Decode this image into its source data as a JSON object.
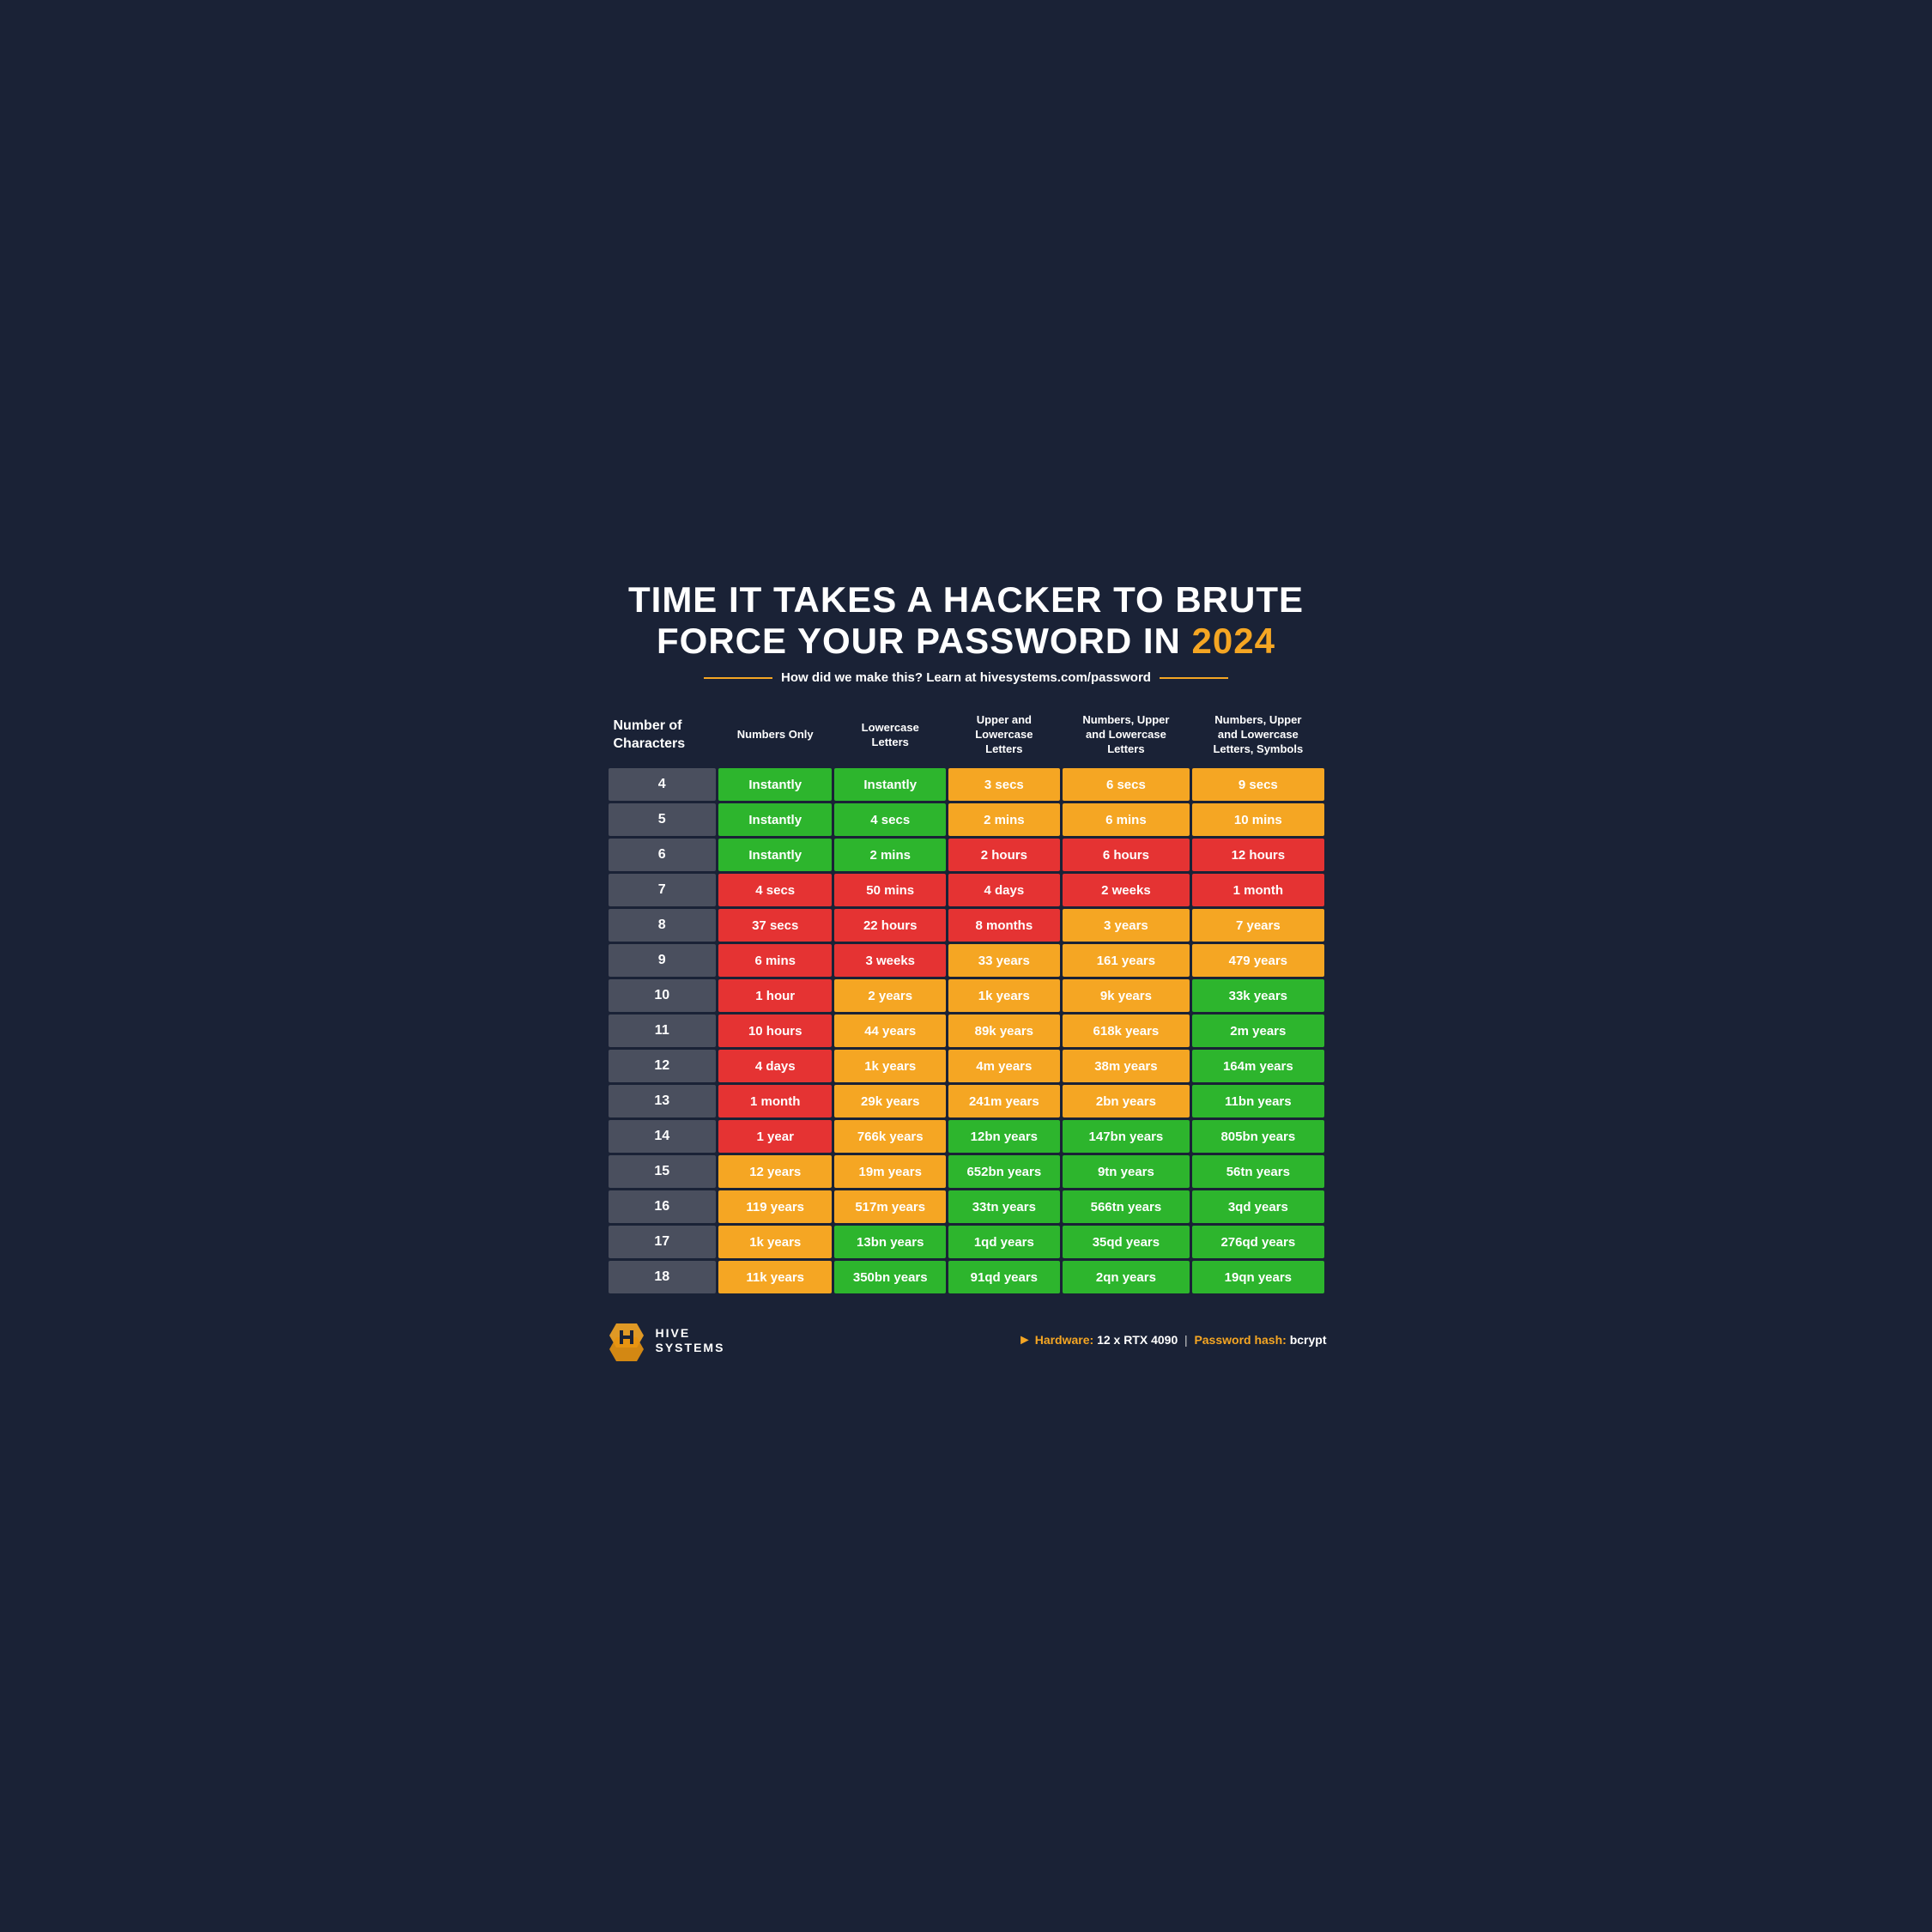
{
  "title": {
    "line1": "TIME IT TAKES A HACKER TO BRUTE",
    "line2": "FORCE YOUR PASSWORD IN",
    "year": "2024"
  },
  "subtitle": "How did we make this? Learn at hivesystems.com/password",
  "columns": [
    "Number of\nCharacters",
    "Numbers Only",
    "Lowercase\nLetters",
    "Upper and\nLowercase\nLetters",
    "Numbers, Upper\nand Lowercase\nLetters",
    "Numbers, Upper\nand Lowercase\nLetters, Symbols"
  ],
  "rows": [
    {
      "chars": "4",
      "data": [
        {
          "value": "Instantly",
          "color": "green"
        },
        {
          "value": "Instantly",
          "color": "green"
        },
        {
          "value": "3 secs",
          "color": "orange"
        },
        {
          "value": "6 secs",
          "color": "orange"
        },
        {
          "value": "9 secs",
          "color": "orange"
        }
      ]
    },
    {
      "chars": "5",
      "data": [
        {
          "value": "Instantly",
          "color": "green"
        },
        {
          "value": "4 secs",
          "color": "green"
        },
        {
          "value": "2 mins",
          "color": "orange"
        },
        {
          "value": "6 mins",
          "color": "orange"
        },
        {
          "value": "10 mins",
          "color": "orange"
        }
      ]
    },
    {
      "chars": "6",
      "data": [
        {
          "value": "Instantly",
          "color": "green"
        },
        {
          "value": "2 mins",
          "color": "green"
        },
        {
          "value": "2 hours",
          "color": "red"
        },
        {
          "value": "6 hours",
          "color": "red"
        },
        {
          "value": "12 hours",
          "color": "red"
        }
      ]
    },
    {
      "chars": "7",
      "data": [
        {
          "value": "4 secs",
          "color": "red"
        },
        {
          "value": "50 mins",
          "color": "red"
        },
        {
          "value": "4 days",
          "color": "red"
        },
        {
          "value": "2 weeks",
          "color": "red"
        },
        {
          "value": "1 month",
          "color": "red"
        }
      ]
    },
    {
      "chars": "8",
      "data": [
        {
          "value": "37 secs",
          "color": "red"
        },
        {
          "value": "22 hours",
          "color": "red"
        },
        {
          "value": "8 months",
          "color": "red"
        },
        {
          "value": "3 years",
          "color": "orange"
        },
        {
          "value": "7 years",
          "color": "orange"
        }
      ]
    },
    {
      "chars": "9",
      "data": [
        {
          "value": "6 mins",
          "color": "red"
        },
        {
          "value": "3 weeks",
          "color": "red"
        },
        {
          "value": "33 years",
          "color": "orange"
        },
        {
          "value": "161 years",
          "color": "orange"
        },
        {
          "value": "479 years",
          "color": "orange"
        }
      ]
    },
    {
      "chars": "10",
      "data": [
        {
          "value": "1 hour",
          "color": "red"
        },
        {
          "value": "2 years",
          "color": "orange"
        },
        {
          "value": "1k years",
          "color": "orange"
        },
        {
          "value": "9k years",
          "color": "orange"
        },
        {
          "value": "33k years",
          "color": "green"
        }
      ]
    },
    {
      "chars": "11",
      "data": [
        {
          "value": "10 hours",
          "color": "red"
        },
        {
          "value": "44 years",
          "color": "orange"
        },
        {
          "value": "89k years",
          "color": "orange"
        },
        {
          "value": "618k years",
          "color": "orange"
        },
        {
          "value": "2m years",
          "color": "green"
        }
      ]
    },
    {
      "chars": "12",
      "data": [
        {
          "value": "4 days",
          "color": "red"
        },
        {
          "value": "1k years",
          "color": "orange"
        },
        {
          "value": "4m years",
          "color": "orange"
        },
        {
          "value": "38m years",
          "color": "orange"
        },
        {
          "value": "164m years",
          "color": "green"
        }
      ]
    },
    {
      "chars": "13",
      "data": [
        {
          "value": "1 month",
          "color": "red"
        },
        {
          "value": "29k years",
          "color": "orange"
        },
        {
          "value": "241m years",
          "color": "orange"
        },
        {
          "value": "2bn years",
          "color": "orange"
        },
        {
          "value": "11bn years",
          "color": "green"
        }
      ]
    },
    {
      "chars": "14",
      "data": [
        {
          "value": "1 year",
          "color": "red"
        },
        {
          "value": "766k years",
          "color": "orange"
        },
        {
          "value": "12bn years",
          "color": "green"
        },
        {
          "value": "147bn years",
          "color": "green"
        },
        {
          "value": "805bn years",
          "color": "green"
        }
      ]
    },
    {
      "chars": "15",
      "data": [
        {
          "value": "12 years",
          "color": "orange"
        },
        {
          "value": "19m years",
          "color": "orange"
        },
        {
          "value": "652bn years",
          "color": "green"
        },
        {
          "value": "9tn years",
          "color": "green"
        },
        {
          "value": "56tn years",
          "color": "green"
        }
      ]
    },
    {
      "chars": "16",
      "data": [
        {
          "value": "119 years",
          "color": "orange"
        },
        {
          "value": "517m years",
          "color": "orange"
        },
        {
          "value": "33tn years",
          "color": "green"
        },
        {
          "value": "566tn years",
          "color": "green"
        },
        {
          "value": "3qd years",
          "color": "green"
        }
      ]
    },
    {
      "chars": "17",
      "data": [
        {
          "value": "1k years",
          "color": "orange"
        },
        {
          "value": "13bn years",
          "color": "green"
        },
        {
          "value": "1qd years",
          "color": "green"
        },
        {
          "value": "35qd years",
          "color": "green"
        },
        {
          "value": "276qd years",
          "color": "green"
        }
      ]
    },
    {
      "chars": "18",
      "data": [
        {
          "value": "11k years",
          "color": "orange"
        },
        {
          "value": "350bn years",
          "color": "green"
        },
        {
          "value": "91qd years",
          "color": "green"
        },
        {
          "value": "2qn years",
          "color": "green"
        },
        {
          "value": "19qn years",
          "color": "green"
        }
      ]
    }
  ],
  "footer": {
    "hardware_label": "Hardware:",
    "hardware_value": "12 x RTX 4090",
    "hash_label": "Password hash:",
    "hash_value": "bcrypt",
    "logo_name": "HIVE\nSYSTEMS"
  }
}
